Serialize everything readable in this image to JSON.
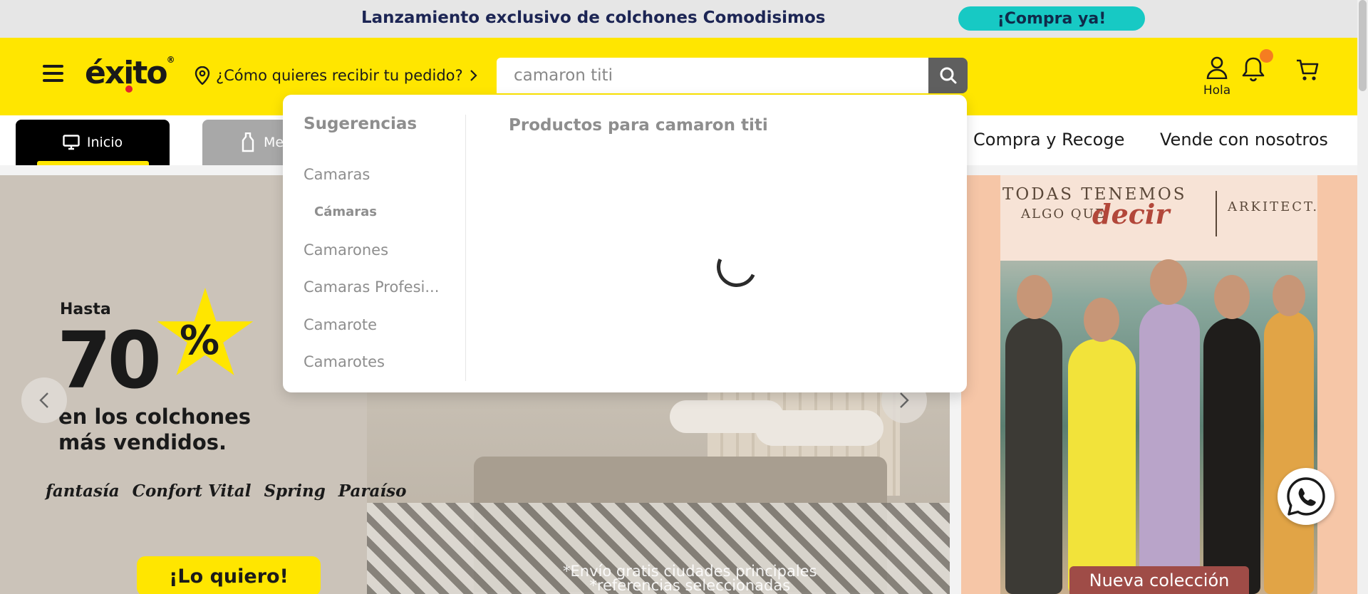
{
  "promo": {
    "text": "Lanzamiento exclusivo de colchones Comodisimos",
    "cta": "¡Compra ya!"
  },
  "header": {
    "logo": "éxito",
    "logo_reg": "®",
    "delivery_prompt": "¿Cómo quieres recibir tu pedido?",
    "search_value": "camaron titi",
    "account_label": "Hola",
    "icons": [
      "menu-icon",
      "location-pin-icon",
      "chevron-right-icon",
      "search-icon",
      "user-icon",
      "bell-icon",
      "cart-icon"
    ]
  },
  "nav": {
    "tabs": [
      {
        "label": "Inicio",
        "icon": "monitor-icon",
        "active": true
      },
      {
        "label": "Me",
        "icon": "bottle-icon",
        "active": false
      }
    ],
    "links": [
      "Compra y Recoge",
      "Vende con nosotros"
    ]
  },
  "dropdown": {
    "suggestions_title": "Sugerencias",
    "suggestions": [
      "Camaras",
      "Cámaras",
      "Camarones",
      "Camaras Profesi...",
      "Camarote",
      "Camarotes"
    ],
    "products_title": "Productos para camaron titi",
    "loading": true
  },
  "banner_main": {
    "hasta": "Hasta",
    "discount": "70",
    "percent": "%",
    "line1": "en los colchones",
    "line2": "más vendidos.",
    "brands": [
      "fantasía",
      "Confort Vital",
      "Spring",
      "Paraíso"
    ],
    "cta": "¡Lo quiero!",
    "note_line1": "*Envío gratis ciudades principales",
    "note_line2": "*referencias seleccionadas"
  },
  "banner_side": {
    "line1": "TODAS TENEMOS",
    "line2": "ALGO QUE",
    "accent": "decir",
    "brand": "ARKITECT.",
    "label": "Nueva colección"
  },
  "colors": {
    "brand_yellow": "#ffe600",
    "promo_teal": "#17c9c4",
    "dark": "#1a1a1a",
    "badge_orange": "#f57d21"
  }
}
